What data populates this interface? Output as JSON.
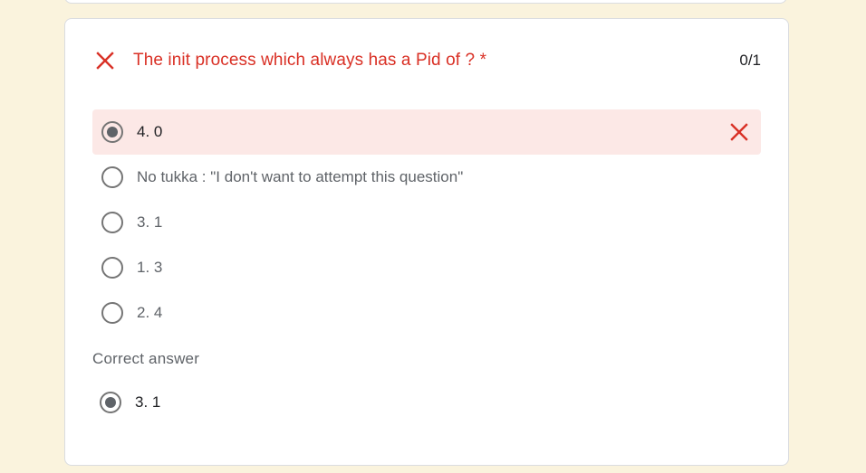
{
  "question": {
    "title": "The init process which always has a Pid of ? *",
    "score": "0/1",
    "status_icon": "close-icon",
    "accent_color": "#d93025"
  },
  "options": [
    {
      "label": "4. 0",
      "selected": true,
      "incorrect": true
    },
    {
      "label": "No tukka : \"I don't want to attempt this question\"",
      "selected": false
    },
    {
      "label": "3. 1",
      "selected": false
    },
    {
      "label": "1. 3",
      "selected": false
    },
    {
      "label": "2. 4",
      "selected": false
    }
  ],
  "correct_answer": {
    "heading": "Correct answer",
    "label": "3. 1"
  }
}
